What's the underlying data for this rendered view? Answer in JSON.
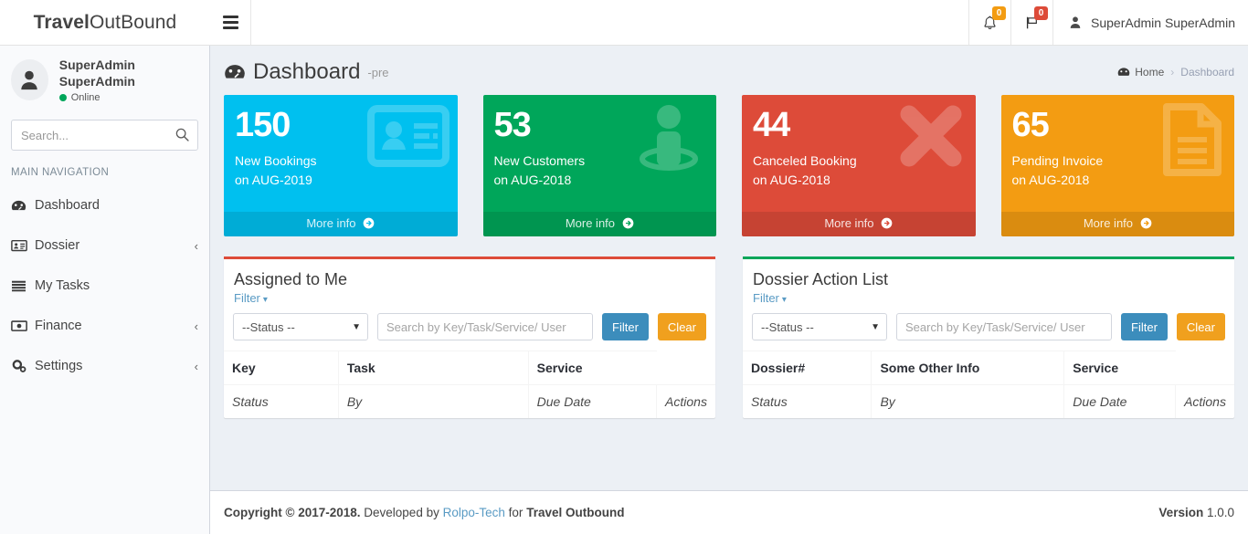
{
  "brand": {
    "bold": "Travel",
    "light": "OutBound"
  },
  "navbar": {
    "toggle_icon": "hamburger-icon",
    "notifications": {
      "icon": "bell-icon",
      "count": "0",
      "color": "#f39c12"
    },
    "flags": {
      "icon": "flag-icon",
      "count": "0",
      "color": "#dd4b39"
    },
    "user_name": "SuperAdmin SuperAdmin",
    "user_icon": "user-icon"
  },
  "sidebar": {
    "user": {
      "name": "SuperAdmin SuperAdmin",
      "status": "Online",
      "status_color": "#00a65a",
      "avatar_icon": "user-avatar-icon"
    },
    "search": {
      "placeholder": "Search...",
      "value": "",
      "icon": "search-icon"
    },
    "nav_header": "MAIN NAVIGATION",
    "items": [
      {
        "label": "Dashboard",
        "icon": "dashboard-icon",
        "arrow": ""
      },
      {
        "label": "Dossier",
        "icon": "id-card-icon",
        "arrow": "‹"
      },
      {
        "label": "My Tasks",
        "icon": "tasks-icon",
        "arrow": ""
      },
      {
        "label": "Finance",
        "icon": "money-icon",
        "arrow": "‹"
      },
      {
        "label": "Settings",
        "icon": "gears-icon",
        "arrow": "‹"
      }
    ]
  },
  "header": {
    "title": "Dashboard",
    "subtitle": "-pre",
    "title_icon": "dashboard-icon",
    "breadcrumb": {
      "home": "Home",
      "home_icon": "dashboard-icon",
      "separator": "›",
      "current": "Dashboard"
    }
  },
  "info_boxes": [
    {
      "number": "150",
      "label": "New Bookings",
      "sub": "on AUG-2019",
      "footer": "More info",
      "color": "#00c0ef",
      "icon": "id-card-icon"
    },
    {
      "number": "53",
      "label": "New Customers",
      "sub": "on AUG-2018",
      "footer": "More info",
      "color": "#00a65a",
      "icon": "user-plus-icon"
    },
    {
      "number": "44",
      "label": "Canceled Booking",
      "sub": "on AUG-2018",
      "footer": "More info",
      "color": "#dd4b39",
      "icon": "times-icon"
    },
    {
      "number": "65",
      "label": "Pending Invoice",
      "sub": "on AUG-2018",
      "footer": "More info",
      "color": "#f39c12",
      "icon": "file-icon"
    }
  ],
  "panels": [
    {
      "title": "Assigned to Me",
      "accent": "#dd4b39",
      "filter_link": "Filter",
      "status_select": {
        "selected": "--Status --",
        "options": [
          "--Status --"
        ]
      },
      "search_placeholder": "Search by Key/Task/Service/ User",
      "search_value": "",
      "btn_filter": "Filter",
      "btn_clear": "Clear",
      "headers": [
        "Key",
        "Task",
        "Service"
      ],
      "row": [
        "Status",
        "By",
        "Due Date",
        "Actions"
      ]
    },
    {
      "title": "Dossier Action List",
      "accent": "#00a65a",
      "filter_link": "Filter",
      "status_select": {
        "selected": "--Status --",
        "options": [
          "--Status --"
        ]
      },
      "search_placeholder": "Search by Key/Task/Service/ User",
      "search_value": "",
      "btn_filter": "Filter",
      "btn_clear": "Clear",
      "headers": [
        "Dossier#",
        "Some Other Info",
        "Service"
      ],
      "row": [
        "Status",
        "By",
        "Due Date",
        "Actions"
      ]
    }
  ],
  "footer": {
    "copyright": "Copyright © 2017-2018.",
    "developed": "Developed by",
    "dev_link": "Rolpo-Tech",
    "for": "for",
    "company": "Travel Outbound",
    "version_label": "Version",
    "version_value": "1.0.0"
  }
}
